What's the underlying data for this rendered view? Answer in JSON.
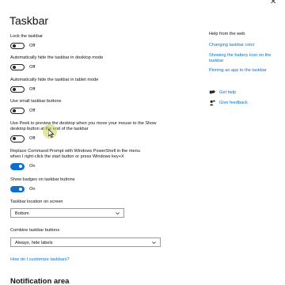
{
  "window": {
    "close_glyph": "✕"
  },
  "page": {
    "title": "Taskbar"
  },
  "settings": [
    {
      "label": "Lock the taskbar",
      "state": "Off",
      "on": false
    },
    {
      "label": "Automatically hide the taskbar in desktop mode",
      "state": "Off",
      "on": false
    },
    {
      "label": "Automatically hide the taskbar in tablet mode",
      "state": "Off",
      "on": false
    },
    {
      "label": "Use small taskbar buttons",
      "state": "Off",
      "on": false
    },
    {
      "label": "Use Peek to preview the desktop when you move your mouse to the Show desktop button at the end of the taskbar",
      "state": "Off",
      "on": false
    },
    {
      "label": "Replace Command Prompt with Windows PowerShell in the menu when I right-click the start button or press Windows key+X",
      "state": "On",
      "on": true
    },
    {
      "label": "Show badges on taskbar buttons",
      "state": "On",
      "on": true
    }
  ],
  "location": {
    "label": "Taskbar location on screen",
    "value": "Bottom"
  },
  "combine": {
    "label": "Combine taskbar buttons",
    "value": "Always, hide labels"
  },
  "customize_link": "How do I customize taskbars?",
  "section_next": "Notification area",
  "sidebar": {
    "heading": "Help from the web",
    "links": [
      "Changing taskbar color",
      "Showing the battery icon on the taskbar",
      "Pinning an app to the taskbar"
    ],
    "actions": [
      {
        "label": "Get help",
        "icon": "help-chat-icon"
      },
      {
        "label": "Give feedback",
        "icon": "feedback-person-icon"
      }
    ]
  },
  "colors": {
    "accent": "#0b6fd1",
    "text": "#111111",
    "background": "#ffffff"
  }
}
